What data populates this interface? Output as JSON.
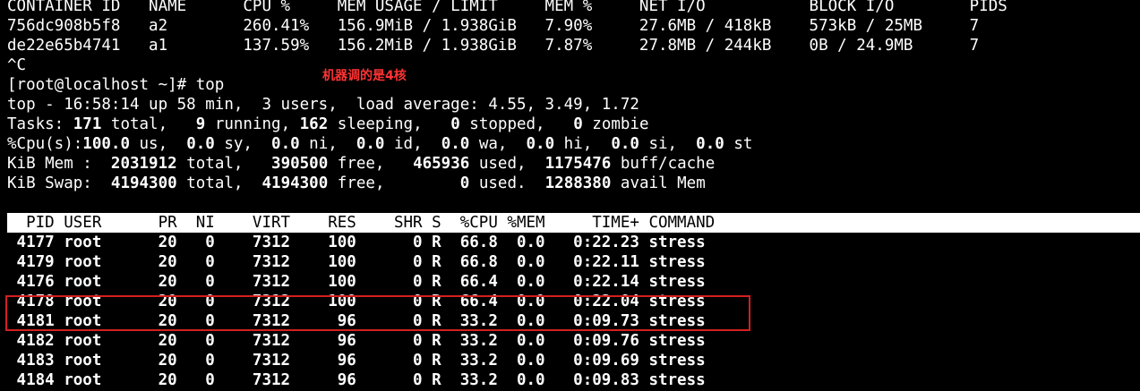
{
  "docker_stats": {
    "header": "CONTAINER ID   NAME      CPU %     MEM USAGE / LIMIT     MEM %     NET I/O           BLOCK I/O        PIDS",
    "rows": [
      "756dc908b5f8   a2        260.41%   156.9MiB / 1.938GiB   7.90%     27.6MB / 418kB    573kB / 25MB     7",
      "de22e65b4741   a1        137.59%   156.2MiB / 1.938GiB   7.87%     27.8MB / 244kB    0B / 24.9MB      7"
    ]
  },
  "interrupt": "^C",
  "annotation": "机器调的是4核",
  "prompt": "[root@localhost ~]# top",
  "top_summary": {
    "uptime": "top - 16:58:14 up 58 min,  3 users,  load average: 4.55, 3.49, 1.72",
    "tasks": [
      "Tasks: ",
      "171",
      " total,   ",
      "9",
      " running, ",
      "162",
      " sleeping,   ",
      "0",
      " stopped,   ",
      "0",
      " zombie"
    ],
    "cpu": [
      "%Cpu(s):",
      "100.0",
      " us,  ",
      "0.0",
      " sy,  ",
      "0.0",
      " ni,  ",
      "0.0",
      " id,  ",
      "0.0",
      " wa,  ",
      "0.0",
      " hi,  ",
      "0.0",
      " si,  ",
      "0.0",
      " st"
    ],
    "mem": [
      "KiB Mem :  ",
      "2031912",
      " total,   ",
      "390500",
      " free,   ",
      "465936",
      " used,  ",
      "1175476",
      " buff/cache"
    ],
    "swap": [
      "KiB Swap:  ",
      "4194300",
      " total,  ",
      "4194300",
      " free,        ",
      "0",
      " used.  ",
      "1288380",
      " avail Mem"
    ]
  },
  "process_table": {
    "header": "  PID USER      PR  NI    VIRT    RES    SHR S  %CPU %MEM     TIME+ COMMAND",
    "rows": [
      " 4177 root      20   0    7312    100      0 R  66.8  0.0   0:22.23 stress",
      " 4179 root      20   0    7312    100      0 R  66.8  0.0   0:22.11 stress",
      " 4176 root      20   0    7312    100      0 R  66.4  0.0   0:22.14 stress",
      " 4178 root      20   0    7312    100      0 R  66.4  0.0   0:22.04 stress",
      " 4181 root      20   0    7312     96      0 R  33.2  0.0   0:09.73 stress",
      " 4182 root      20   0    7312     96      0 R  33.2  0.0   0:09.76 stress",
      " 4183 root      20   0    7312     96      0 R  33.2  0.0   0:09.69 stress",
      " 4184 root      20   0    7312     96      0 R  33.2  0.0   0:09.83 stress"
    ]
  },
  "colors": {
    "background": "#000000",
    "text": "#ffffff",
    "annotation": "#ff3333",
    "highlight_box": "#d41f1f"
  }
}
